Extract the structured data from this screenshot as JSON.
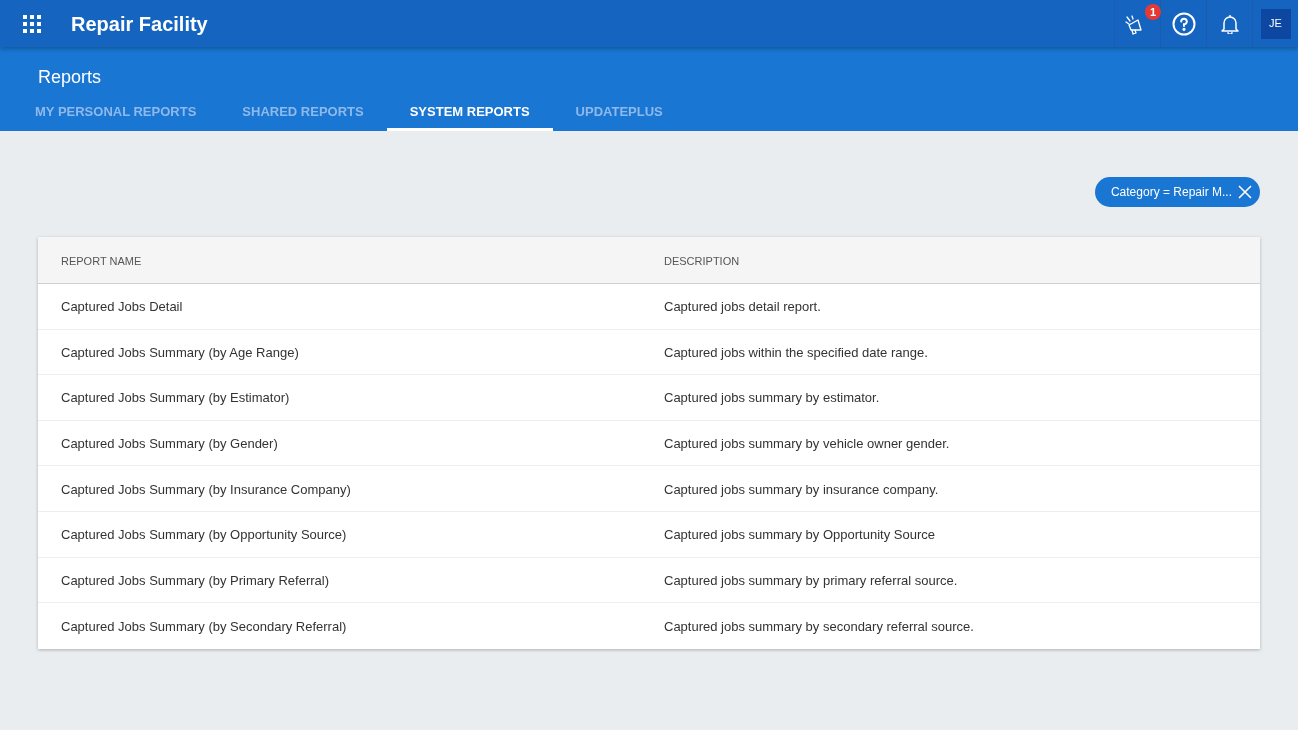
{
  "app_bar": {
    "title": "Repair Facility",
    "announcement_badge": "1",
    "avatar_initials": "JE"
  },
  "page_header": {
    "title": "Reports",
    "tabs": [
      {
        "label": "MY PERSONAL REPORTS",
        "selected": false
      },
      {
        "label": "SHARED REPORTS",
        "selected": false
      },
      {
        "label": "SYSTEM REPORTS",
        "selected": true
      },
      {
        "label": "UPDATEPLUS",
        "selected": false
      }
    ]
  },
  "filter_chips": [
    {
      "label": "Category = Repair M..."
    }
  ],
  "table": {
    "columns": [
      "REPORT NAME",
      "DESCRIPTION"
    ],
    "rows": [
      {
        "report_name": "Captured Jobs Detail",
        "description": "Captured jobs detail report."
      },
      {
        "report_name": "Captured Jobs Summary (by Age Range)",
        "description": "Captured jobs within the specified date range."
      },
      {
        "report_name": "Captured Jobs Summary (by Estimator)",
        "description": "Captured jobs summary by estimator."
      },
      {
        "report_name": "Captured Jobs Summary (by Gender)",
        "description": "Captured jobs summary by vehicle owner gender."
      },
      {
        "report_name": "Captured Jobs Summary (by Insurance Company)",
        "description": "Captured jobs summary by insurance company."
      },
      {
        "report_name": "Captured Jobs Summary (by Opportunity Source)",
        "description": "Captured jobs summary by Opportunity Source"
      },
      {
        "report_name": "Captured Jobs Summary (by Primary Referral)",
        "description": "Captured jobs summary by primary referral source."
      },
      {
        "report_name": "Captured Jobs Summary (by Secondary Referral)",
        "description": "Captured jobs summary by secondary referral source."
      }
    ]
  }
}
